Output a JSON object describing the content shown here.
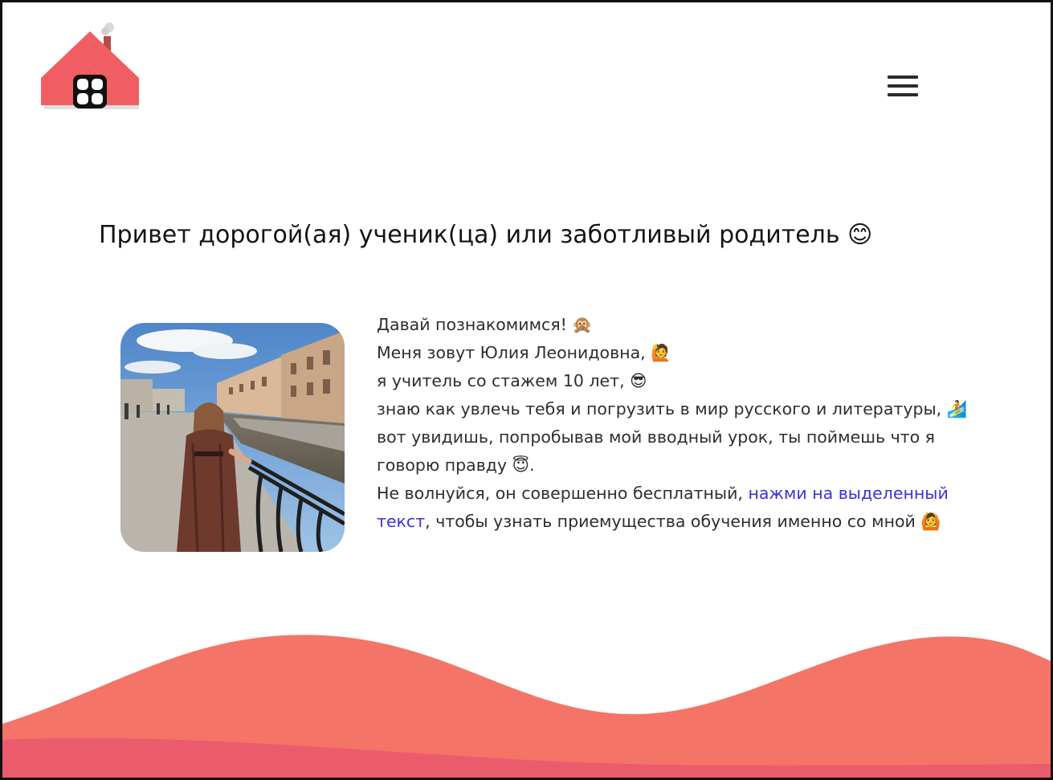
{
  "header": {
    "logo_icon": "house-logo-icon",
    "menu_icon": "hamburger-menu-icon"
  },
  "main": {
    "headline": "Привет дорогой(ая) ученик(ца) или заботливый родитель 😊",
    "photo_icon": "teacher-photo",
    "intro": {
      "line1": "Давай познакомимся! 🙊",
      "line2": "Меня зовут Юлия Леонидовна, 🙋",
      "line3": "я учитель со стажем 10 лет, 😎",
      "line4": "знаю как увлечь тебя и погрузить в мир русского и литературы, 🏄",
      "line5": "вот увидишь, попробывав мой вводный урок, ты поймешь что я",
      "line6": "говорю правду 😇.",
      "line7_prefix": "Не волнуйся, он совершенно бесплатный, ",
      "link_part1": "нажми на выделенный",
      "link_part2": "текст",
      "line8_suffix": ", чтобы узнать приемущества обучения именно со мной 🙆"
    }
  },
  "colors": {
    "accent": "#f2666a",
    "wave_front": "#f47468",
    "wave_back": "#ec5b6b",
    "link": "#3a32d8"
  }
}
